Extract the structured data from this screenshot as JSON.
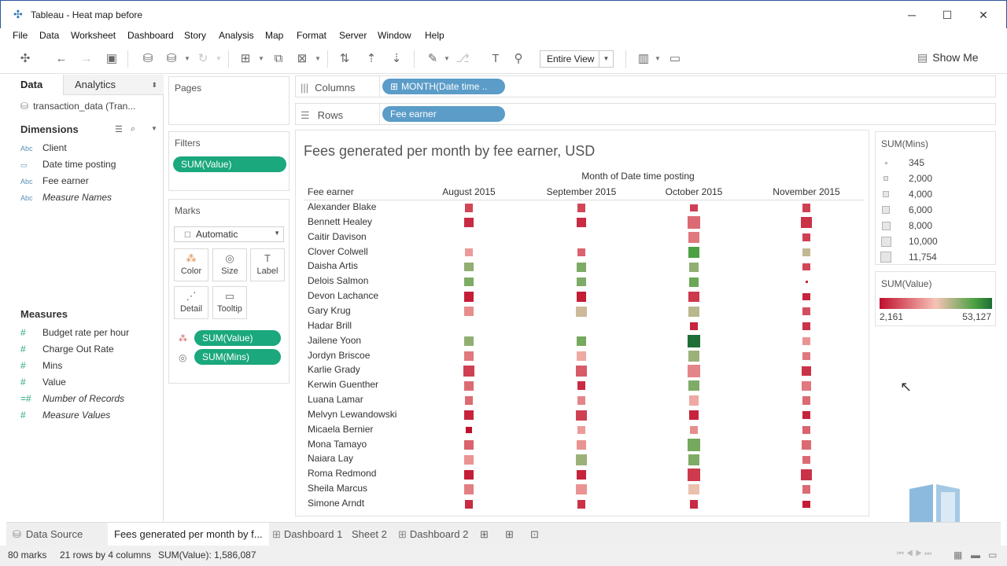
{
  "window": {
    "title": "Tableau - Heat map before",
    "min": "─",
    "max": "☐",
    "close": "✕"
  },
  "menu": [
    "File",
    "Data",
    "Worksheet",
    "Dashboard",
    "Story",
    "Analysis",
    "Map",
    "Format",
    "Server",
    "Window",
    "Help"
  ],
  "toolbar": {
    "view_select": "Entire View",
    "show_me": "Show Me"
  },
  "left": {
    "tab_data": "Data",
    "tab_analytics": "Analytics",
    "datasource": "transaction_data (Tran...",
    "dimensions_header": "Dimensions",
    "dimensions": [
      {
        "type": "Abc",
        "label": "Client",
        "italic": false
      },
      {
        "type": "▭",
        "label": "Date time posting",
        "italic": false
      },
      {
        "type": "Abc",
        "label": "Fee earner",
        "italic": false
      },
      {
        "type": "Abc",
        "label": "Measure Names",
        "italic": true
      }
    ],
    "measures_header": "Measures",
    "measures": [
      {
        "type": "#",
        "label": "Budget rate per hour",
        "italic": false
      },
      {
        "type": "#",
        "label": "Charge Out Rate",
        "italic": false
      },
      {
        "type": "#",
        "label": "Mins",
        "italic": false
      },
      {
        "type": "#",
        "label": "Value",
        "italic": false
      },
      {
        "type": "=#",
        "label": "Number of Records",
        "italic": true
      },
      {
        "type": "#",
        "label": "Measure Values",
        "italic": true
      }
    ]
  },
  "pages": {
    "header": "Pages"
  },
  "filters": {
    "header": "Filters",
    "pill": "SUM(Value)"
  },
  "marks": {
    "header": "Marks",
    "type": "Automatic",
    "buttons": [
      "Color",
      "Size",
      "Label",
      "Detail",
      "Tooltip"
    ],
    "pills": [
      "SUM(Value)",
      "SUM(Mins)"
    ]
  },
  "shelves": {
    "columns_label": "Columns",
    "columns_pill": "MONTH(Date time ..",
    "rows_label": "Rows",
    "rows_pill": "Fee earner"
  },
  "chart_data": {
    "type": "heatmap",
    "title": "Fees generated per month by fee earner, USD",
    "column_axis_title": "Month of Date time posting",
    "row_header": "Fee earner",
    "columns": [
      "August 2015",
      "September 2015",
      "October 2015",
      "November 2015"
    ],
    "rows": [
      "Alexander Blake",
      "Bennett Healey",
      "Caitir Davison",
      "Clover Colwell",
      "Daisha Artis",
      "Delois Salmon",
      "Devon Lachance",
      "Gary Krug",
      "Hadar Brill",
      "Jailene Yoon",
      "Jordyn Briscoe",
      "Karlie Grady",
      "Kerwin Guenther",
      "Luana Lamar",
      "Melvyn Lewandowski",
      "Micaela Bernier",
      "Mona Tamayo",
      "Naiara Lay",
      "Roma Redmond",
      "Sheila Marcus",
      "Simone Arndt"
    ],
    "color_measure": "SUM(Value)",
    "size_measure": "SUM(Mins)",
    "value_range": [
      2161,
      53127
    ],
    "mins_range": [
      345,
      11754
    ],
    "value": [
      [
        10000,
        10000,
        9000,
        9000
      ],
      [
        6000,
        6000,
        15000,
        7000
      ],
      [
        null,
        null,
        17000,
        9000
      ],
      [
        22000,
        14000,
        45000,
        33000
      ],
      [
        38000,
        40000,
        38000,
        10000
      ],
      [
        40000,
        40000,
        42000,
        6000
      ],
      [
        4000,
        4000,
        8000,
        5000
      ],
      [
        20000,
        32000,
        34000,
        11000
      ],
      [
        null,
        null,
        5000,
        7000
      ],
      [
        38000,
        41000,
        53127,
        21000
      ],
      [
        17000,
        24000,
        37000,
        17000
      ],
      [
        9000,
        13000,
        19000,
        7000
      ],
      [
        15000,
        6000,
        40000,
        17000
      ],
      [
        15000,
        19000,
        24000,
        15000
      ],
      [
        5000,
        9000,
        5000,
        5000
      ],
      [
        2161,
        22000,
        20000,
        14000
      ],
      [
        14000,
        21000,
        41000,
        15000
      ],
      [
        21000,
        37000,
        40000,
        15000
      ],
      [
        4000,
        5000,
        8000,
        7000
      ],
      [
        18000,
        21000,
        29000,
        15000
      ],
      [
        6000,
        7000,
        6000,
        4000
      ]
    ],
    "mins": [
      [
        4000,
        4000,
        3500,
        4000
      ],
      [
        6000,
        6000,
        11754,
        8000
      ],
      [
        null,
        null,
        8000,
        4000
      ],
      [
        4000,
        3500,
        8000,
        3500
      ],
      [
        5000,
        6000,
        6000,
        3000
      ],
      [
        5000,
        5000,
        6000,
        345
      ],
      [
        6000,
        6000,
        8000,
        3500
      ],
      [
        6000,
        8000,
        8000,
        3500
      ],
      [
        null,
        null,
        4000,
        3500
      ],
      [
        6000,
        6000,
        11000,
        4000
      ],
      [
        6000,
        6000,
        8000,
        4000
      ],
      [
        8000,
        8000,
        11754,
        6000
      ],
      [
        6000,
        4000,
        8000,
        6000
      ],
      [
        4000,
        4000,
        6000,
        4000
      ],
      [
        6000,
        8000,
        6000,
        4000
      ],
      [
        2000,
        4000,
        4000,
        3500
      ],
      [
        6000,
        6000,
        11000,
        6000
      ],
      [
        6000,
        8000,
        8000,
        4000
      ],
      [
        6000,
        6000,
        11000,
        8000
      ],
      [
        6000,
        8000,
        8000,
        4000
      ],
      [
        4000,
        4000,
        4000,
        3500
      ]
    ]
  },
  "size_legend": {
    "header": "SUM(Mins)",
    "items": [
      "345",
      "2,000",
      "4,000",
      "6,000",
      "8,000",
      "10,000",
      "11,754"
    ]
  },
  "color_legend": {
    "header": "SUM(Value)",
    "min_label": "2,161",
    "max_label": "53,127",
    "colors": [
      "#c0102e",
      "#f7c3b7",
      "#48a040",
      "#1f6e37"
    ]
  },
  "tabs": {
    "data_source": "Data Source",
    "active": "Fees generated per month by f...",
    "others": [
      "Dashboard 1",
      "Sheet 2",
      "Dashboard 2"
    ]
  },
  "status": {
    "marks": "80 marks",
    "rows": "21 rows by 4 columns",
    "sum": "SUM(Value): 1,586,087"
  }
}
